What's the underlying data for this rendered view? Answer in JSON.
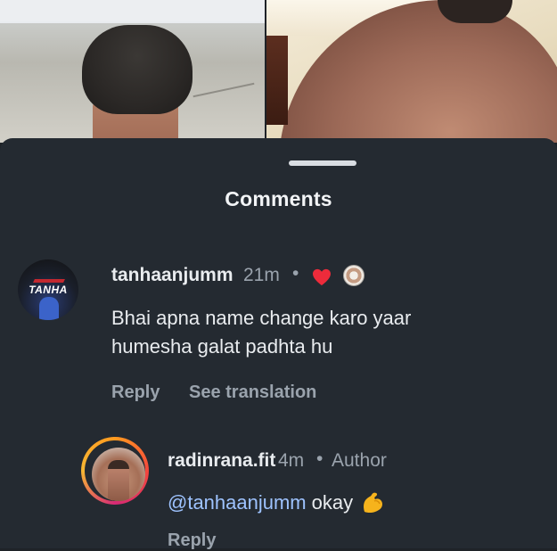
{
  "sheet": {
    "title": "Comments"
  },
  "comments": [
    {
      "username": "tanhaanjumm",
      "time": "21m",
      "separator": "•",
      "avatar_logo_text": "TANHA",
      "text": "Bhai apna name change karo yaar humesha galat padhta hu",
      "reply_label": "Reply",
      "translate_label": "See translation",
      "liked_by_author": true,
      "heart_color": "#ed2b3b"
    },
    {
      "username": "radinrana.fit",
      "time": "4m",
      "separator": "•",
      "badge": "Author",
      "mention": "@tanhaanjumm",
      "text": "okay",
      "emoji": "flexed-biceps-icon",
      "reply_label": "Reply"
    }
  ],
  "colors": {
    "sheet_bg": "#242a31",
    "mention": "#9ec3ff",
    "muted": "#9aa3ad",
    "text": "#e9ecef"
  }
}
